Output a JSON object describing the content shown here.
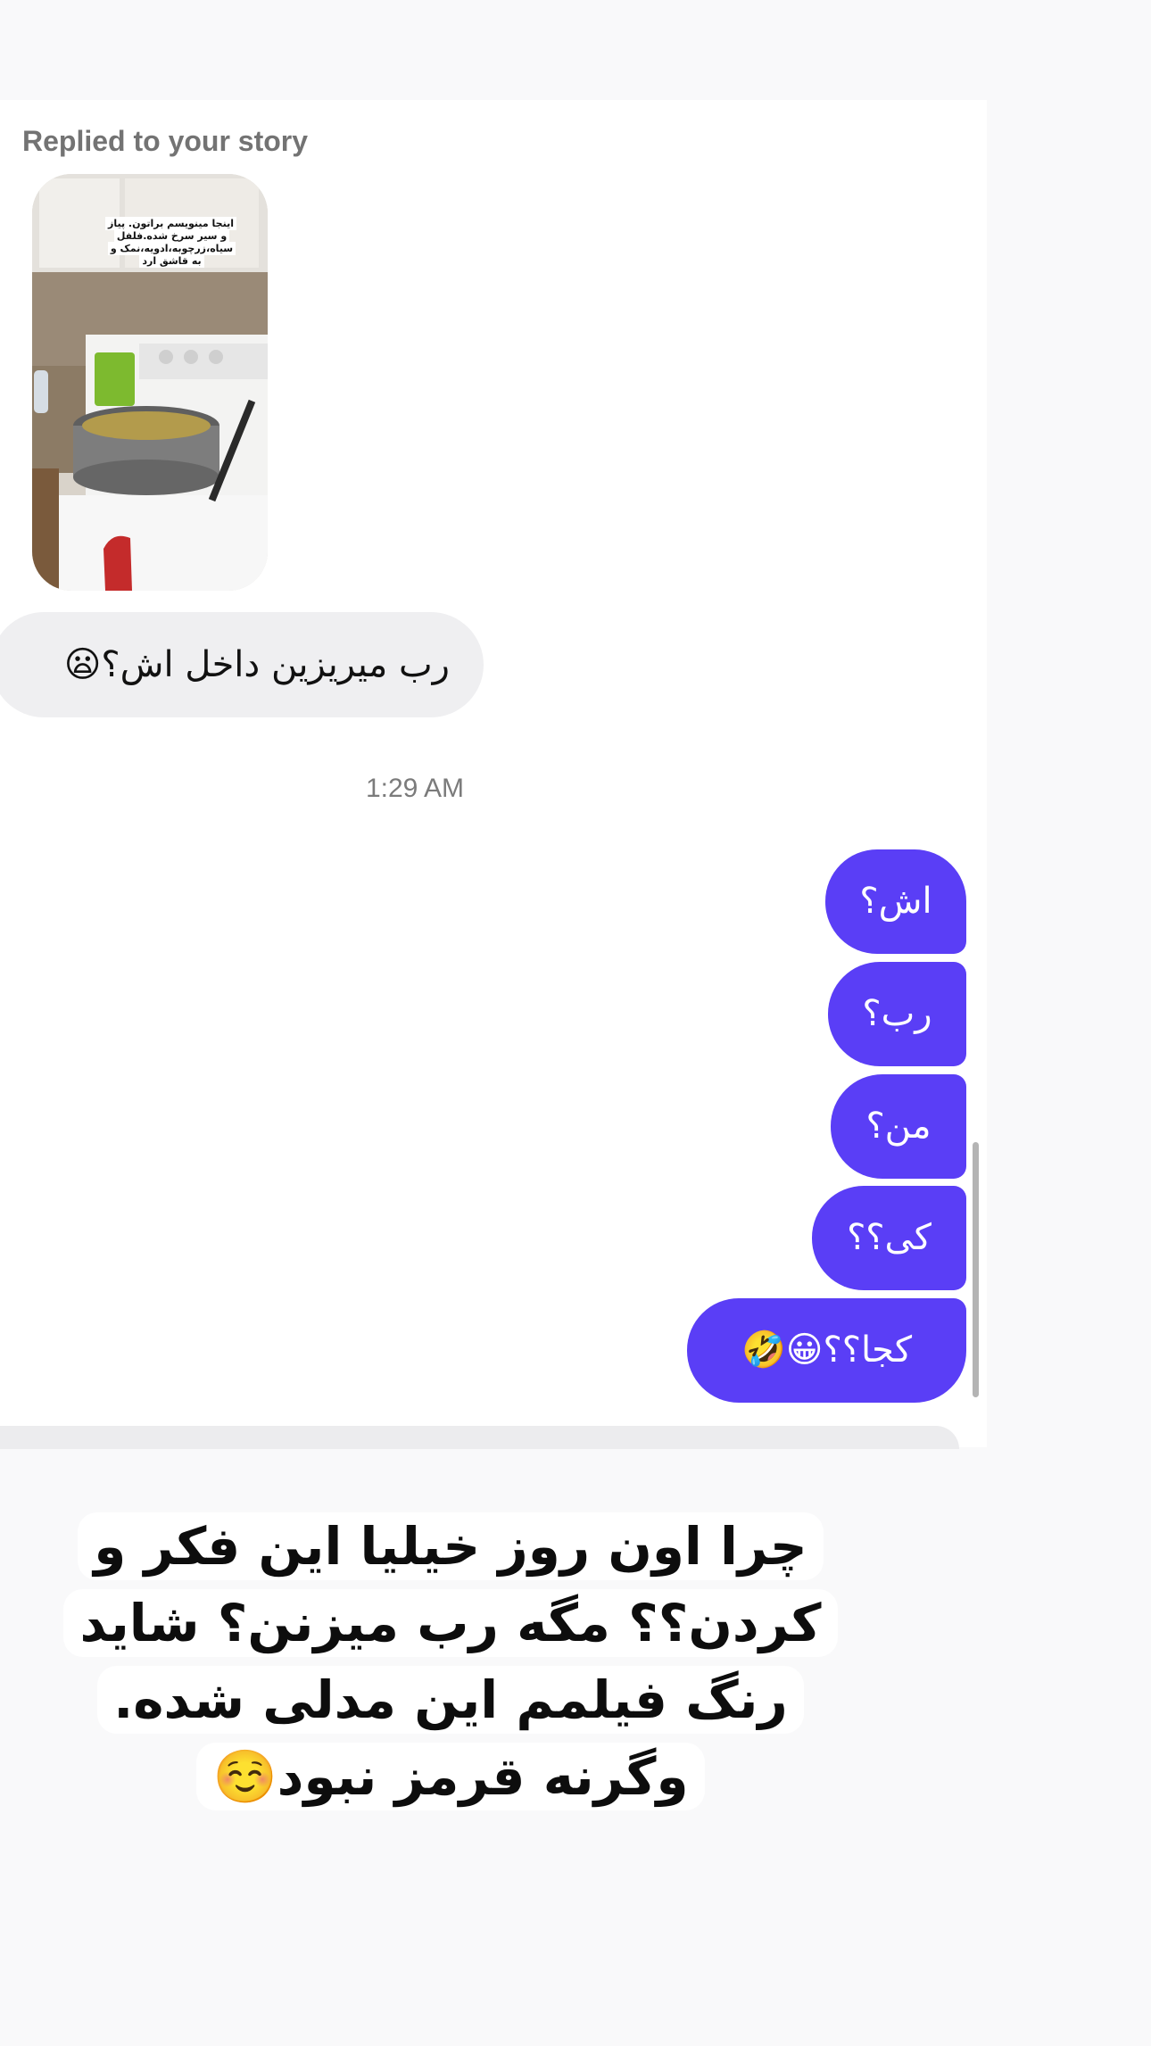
{
  "thread": {
    "replied_label": "Replied to your story",
    "story_caption": "اینجا مینویسم براتون. پیاز و سیر سرخ شده.فلفل سیاه،زرچوبه،ادویه،نمک و به قاشق ارد",
    "incoming_message": "رب میریزین داخل اش؟😦",
    "timestamp": "1:29 AM",
    "outgoing_messages": [
      "اش؟",
      "رب؟",
      "من؟",
      "کی؟؟",
      "کجا؟؟😀🤣"
    ]
  },
  "overlay_caption": "چرا اون روز خیلیا این فکر و کردن؟؟ مگه رب میزنن؟ شاید رنگ فیلمم این مدلی شده. وگرنه قرمز نبود☺️",
  "colors": {
    "outgoing_bubble": "#5a3ef6",
    "incoming_bubble": "#efeff1",
    "background": "#f9f9fa"
  }
}
